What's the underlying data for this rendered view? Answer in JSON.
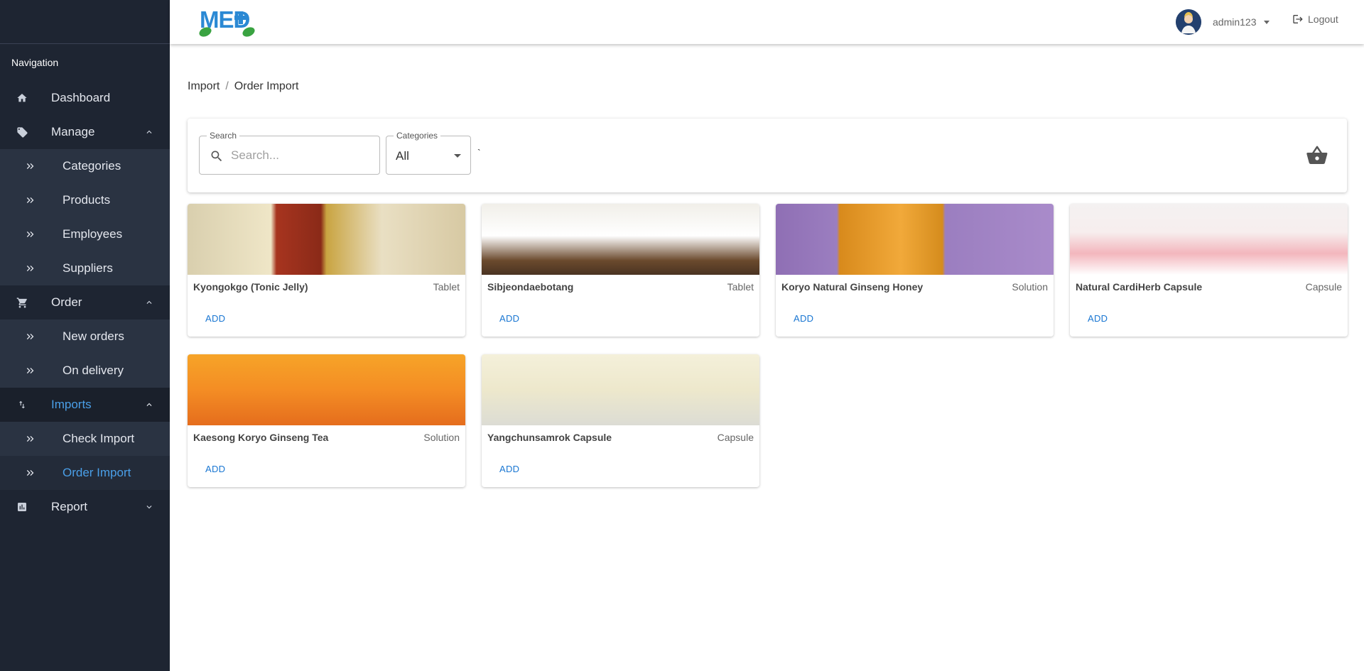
{
  "app": {
    "logo_text": "MED"
  },
  "sidebar": {
    "heading": "Navigation",
    "items": [
      {
        "label": "Dashboard",
        "icon": "home-icon"
      },
      {
        "label": "Manage",
        "icon": "tag-icon"
      },
      {
        "label": "Categories",
        "icon": "double-chevron-right-icon"
      },
      {
        "label": "Products",
        "icon": "double-chevron-right-icon"
      },
      {
        "label": "Employees",
        "icon": "double-chevron-right-icon"
      },
      {
        "label": "Suppliers",
        "icon": "double-chevron-right-icon"
      },
      {
        "label": "Order",
        "icon": "cart-icon"
      },
      {
        "label": "New orders",
        "icon": "double-chevron-right-icon"
      },
      {
        "label": "On delivery",
        "icon": "double-chevron-right-icon"
      },
      {
        "label": "Imports",
        "icon": "import-export-icon"
      },
      {
        "label": "Check Import",
        "icon": "double-chevron-right-icon"
      },
      {
        "label": "Order Import",
        "icon": "double-chevron-right-icon"
      },
      {
        "label": "Report",
        "icon": "bar-chart-icon"
      }
    ]
  },
  "header": {
    "username": "admin123",
    "logout_label": "Logout"
  },
  "breadcrumb": {
    "parent": "Import",
    "separator": "/",
    "current": "Order Import"
  },
  "toolbar": {
    "search_label": "Search",
    "search_placeholder": "Search...",
    "categories_label": "Categories",
    "categories_value": "All",
    "stray_char": "`"
  },
  "products": [
    {
      "name": "Kyongokgo (Tonic Jelly)",
      "type": "Tablet",
      "add_label": "ADD"
    },
    {
      "name": "Sibjeondaebotang",
      "type": "Tablet",
      "add_label": "ADD"
    },
    {
      "name": "Koryo Natural Ginseng Honey",
      "type": "Solution",
      "add_label": "ADD"
    },
    {
      "name": "Natural CardiHerb Capsule",
      "type": "Capsule",
      "add_label": "ADD"
    },
    {
      "name": "Kaesong Koryo Ginseng Tea",
      "type": "Solution",
      "add_label": "ADD"
    },
    {
      "name": "Yangchunsamrok Capsule",
      "type": "Capsule",
      "add_label": "ADD"
    }
  ],
  "colors": {
    "sidebar_bg": "#1e2532",
    "active_link": "#4a9fe8",
    "add_button": "#1976d2"
  }
}
